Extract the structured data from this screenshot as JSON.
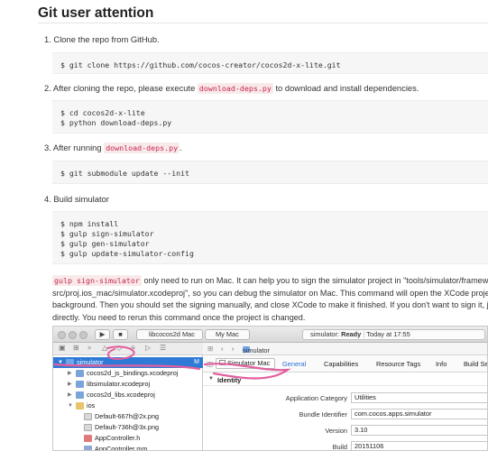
{
  "heading": "Git user attention",
  "steps": {
    "s1_text": "1. Clone the repo from GitHub.",
    "s1_code": [
      "$ git clone https://github.com/cocos-creator/cocos2d-x-lite.git"
    ],
    "s2_before": "2. After cloning the repo, please execute ",
    "s2_code_inline": "download-deps.py",
    "s2_after": " to download and install dependencies.",
    "s2_code": [
      "$ cd cocos2d-x-lite",
      "$ python download-deps.py"
    ],
    "s3_before": "3. After running ",
    "s3_code_inline": "download-deps.py",
    "s3_after": ".",
    "s3_code": [
      "$ git submodule update --init"
    ],
    "s4_text": "4. Build simulator",
    "s4_code": [
      "$ npm install",
      "$ gulp sign-simulator",
      "$ gulp gen-simulator",
      "$ gulp update-simulator-config"
    ]
  },
  "note": {
    "inline": "gulp sign-simulator",
    "l1_rest": " only need to run on Mac. It can help you to sign the simulator project in \"tools/simulator/frameworks/runt",
    "l2": "src/proj.ios_mac/simulator.xcodeproj\", so you can debug the simulator on Mac. This command will open the XCode project in the",
    "l3": "background. Then you should set the signing manually, and close XCode to make it finished. If you don't want to sign it, just close",
    "l4": "directly. You need to rerun this command once the project is changed."
  },
  "xcode": {
    "scheme": "libcocos2d Mac",
    "destination": "My Mac",
    "status_app": "simulator:",
    "status_state": "Ready",
    "status_time": "Today at 17:55",
    "jump_file": "simulator",
    "sidebar": [
      {
        "label": "simulator",
        "mark": "M"
      },
      {
        "label": "cocos2d_js_bindings.xcodeproj",
        "mark": ""
      },
      {
        "label": "libsimulator.xcodeproj",
        "mark": ""
      },
      {
        "label": "cocos2d_libs.xcodeproj",
        "mark": ""
      },
      {
        "label": "ios",
        "mark": ""
      },
      {
        "label": "Default-667h@2x.png",
        "mark": ""
      },
      {
        "label": "Default-736h@3x.png",
        "mark": ""
      },
      {
        "label": "AppController.h",
        "mark": ""
      },
      {
        "label": "AppController.mm",
        "mark": ""
      }
    ],
    "target_label": "Simulator Mac",
    "tabs": [
      "General",
      "Capabilities",
      "Resource Tags",
      "Info",
      "Build Se"
    ],
    "section": "Identity",
    "fields": [
      {
        "label": "Application Category",
        "value": "Utilities"
      },
      {
        "label": "Bundle Identifier",
        "value": "com.cocos.apps.simulator"
      },
      {
        "label": "Version",
        "value": "3.10"
      },
      {
        "label": "Build",
        "value": "20151106"
      }
    ],
    "highlight_color": "#e25f9e",
    "selection_color": "#2f7ad6"
  }
}
